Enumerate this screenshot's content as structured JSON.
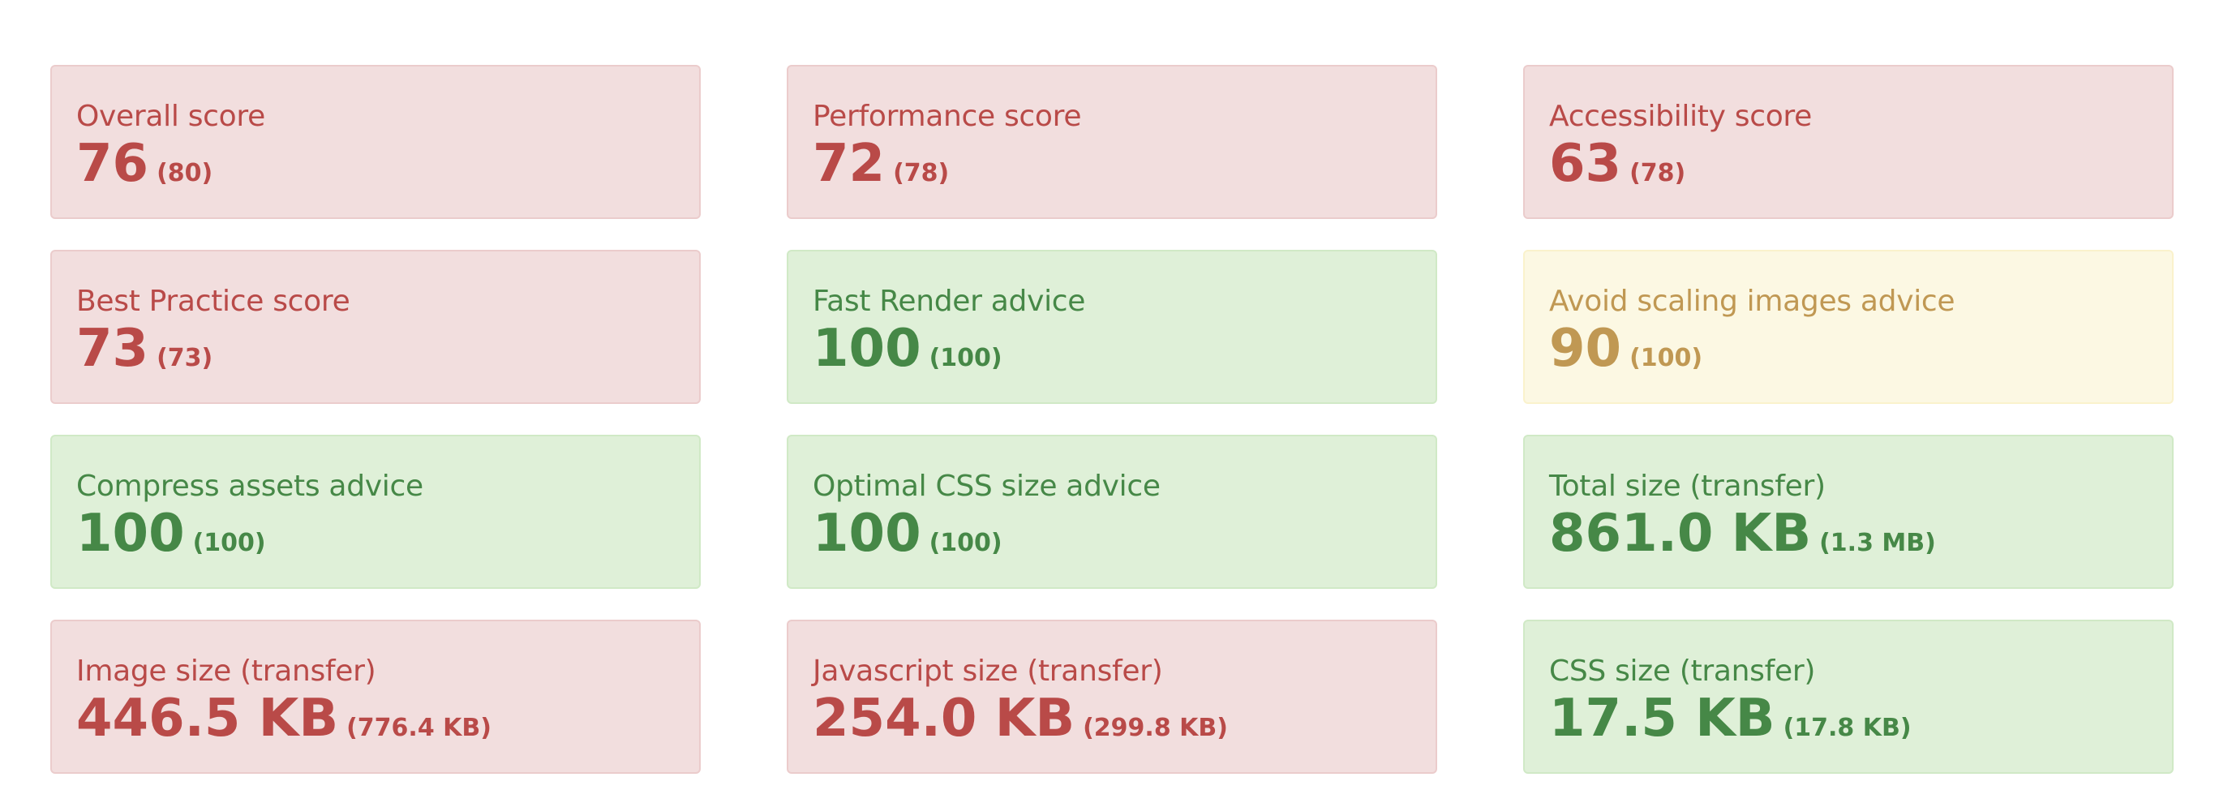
{
  "cards": [
    {
      "title": "Overall score",
      "value": "76",
      "ref": "(80)",
      "status": "bad"
    },
    {
      "title": "Performance score",
      "value": "72",
      "ref": "(78)",
      "status": "bad"
    },
    {
      "title": "Accessibility score",
      "value": "63",
      "ref": "(78)",
      "status": "bad"
    },
    {
      "title": "Best Practice score",
      "value": "73",
      "ref": "(73)",
      "status": "bad"
    },
    {
      "title": "Fast Render advice",
      "value": "100",
      "ref": "(100)",
      "status": "good"
    },
    {
      "title": "Avoid scaling images advice",
      "value": "90",
      "ref": "(100)",
      "status": "warn"
    },
    {
      "title": "Compress assets advice",
      "value": "100",
      "ref": "(100)",
      "status": "good"
    },
    {
      "title": "Optimal CSS size advice",
      "value": "100",
      "ref": "(100)",
      "status": "good"
    },
    {
      "title": "Total size (transfer)",
      "value": "861.0 KB",
      "ref": "(1.3 MB)",
      "status": "good"
    },
    {
      "title": "Image size (transfer)",
      "value": "446.5 KB",
      "ref": "(776.4 KB)",
      "status": "bad"
    },
    {
      "title": "Javascript size (transfer)",
      "value": "254.0 KB",
      "ref": "(299.8 KB)",
      "status": "bad"
    },
    {
      "title": "CSS size (transfer)",
      "value": "17.5 KB",
      "ref": "(17.8 KB)",
      "status": "good"
    }
  ],
  "colors": {
    "bad_bg": "#f2dede",
    "bad_text": "#b94a48",
    "good_bg": "#dff0d8",
    "good_text": "#468847",
    "warn_bg": "#fcf8e3",
    "warn_text": "#c09853"
  }
}
